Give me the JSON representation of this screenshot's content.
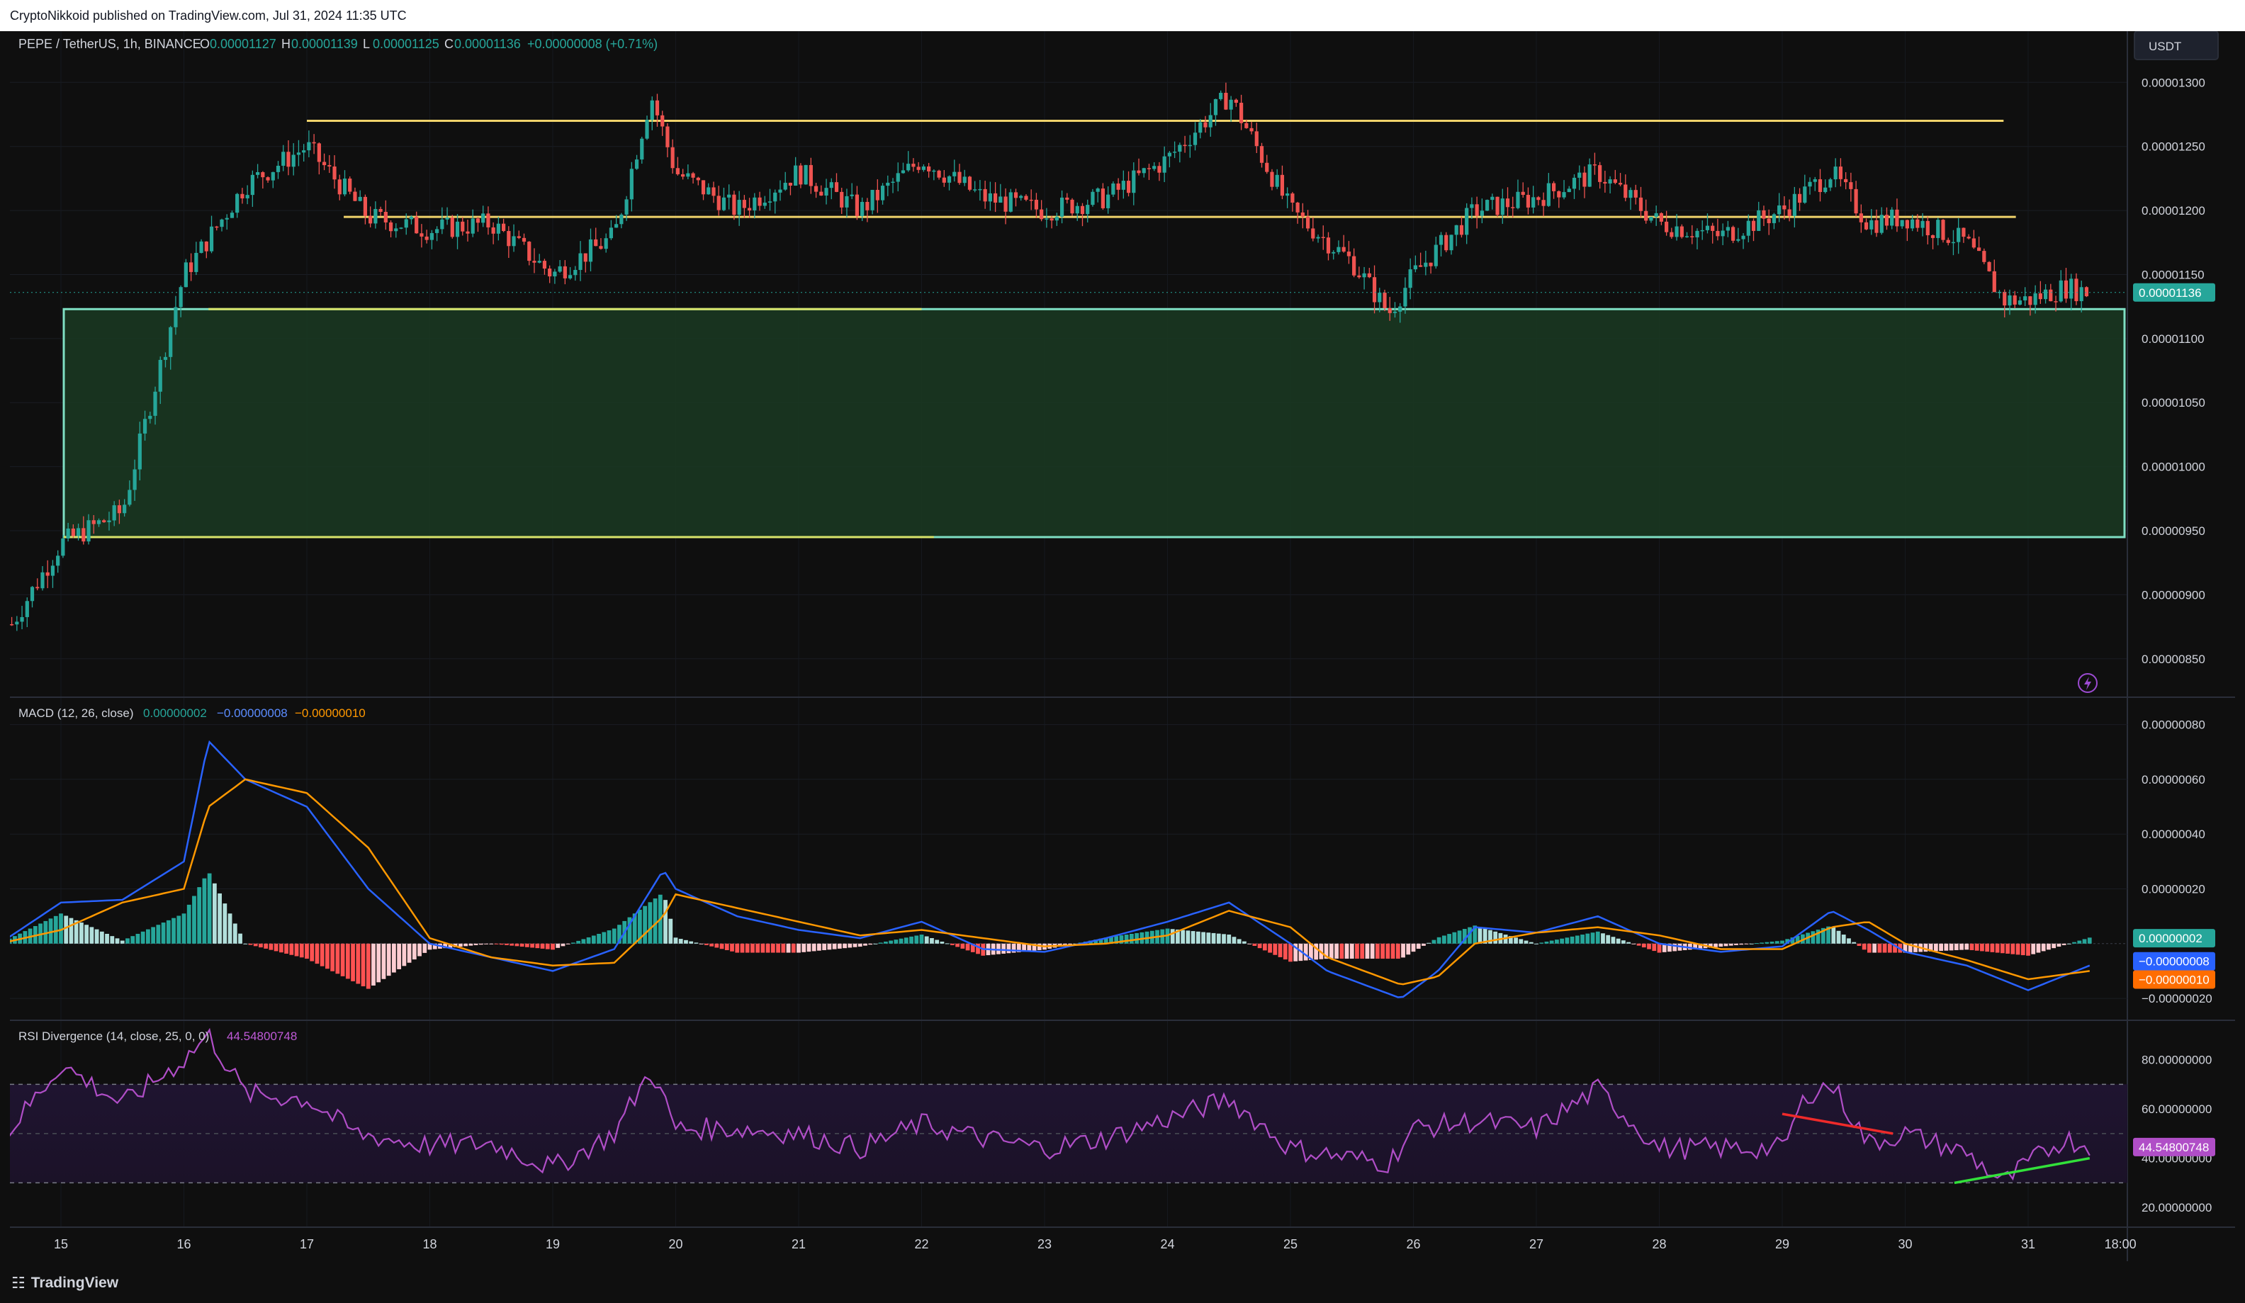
{
  "header": {
    "publisher": "CryptoNikkoid published on TradingView.com, Jul 31, 2024 11:35 UTC"
  },
  "footer": {
    "brand": "TradingView",
    "logo_glyph": "☷"
  },
  "currency_button": "USDT",
  "colors": {
    "up": "#26a69a",
    "down": "#ef5350",
    "zone": "#1b4d2a",
    "resistance": "#f0d36b",
    "macd": "#2962ff",
    "signal": "#ff9800",
    "rsi": "#b04ec7"
  },
  "price_pane": {
    "symbol": "PEPE / TetherUS, 1h, BINANCE",
    "ohlc": [
      {
        "k": "O",
        "v": "0.00001127"
      },
      {
        "k": "H",
        "v": "0.00001139"
      },
      {
        "k": "L",
        "v": "0.00001125"
      },
      {
        "k": "C",
        "v": "0.00001136"
      }
    ],
    "change": "+0.00000008 (+0.71%)",
    "last_price_label": "0.00001136",
    "y_ticks": [
      "0.00001300",
      "0.00001250",
      "0.00001200",
      "0.00001150",
      "0.00001100",
      "0.00001050",
      "0.00001000",
      "0.00000950",
      "0.00000900",
      "0.00000850"
    ],
    "alert_icon": "lightning-icon"
  },
  "macd_pane": {
    "title": "MACD (12, 26, close)",
    "v1": "0.00000002",
    "v2": "−0.00000008",
    "v3": "−0.00000010",
    "y_ticks": [
      "0.00000080",
      "0.00000060",
      "0.00000040",
      "0.00000020",
      "−0.00000020"
    ],
    "labels": [
      "0.00000002",
      "−0.00000008",
      "−0.00000010"
    ]
  },
  "rsi_pane": {
    "title": "RSI Divergence (14, close, 25, 0, 0)",
    "value": "44.54800748",
    "y_ticks": [
      "80.00000000",
      "60.00000000",
      "40.00000000",
      "20.00000000"
    ],
    "label": "44.54800748"
  },
  "time_axis": [
    "15",
    "16",
    "17",
    "18",
    "19",
    "20",
    "21",
    "22",
    "23",
    "24",
    "25",
    "26",
    "27",
    "28",
    "29",
    "30",
    "31",
    "18:00"
  ],
  "chart_data": {
    "type": "candlestick",
    "price_range": [
      8.2e-06,
      1.34e-05
    ],
    "x_days": [
      "15",
      "16",
      "17",
      "18",
      "19",
      "20",
      "21",
      "22",
      "23",
      "24",
      "25",
      "26",
      "27",
      "28",
      "29",
      "30",
      "31"
    ],
    "close_series_approx": [
      {
        "day": "14.6",
        "close": 8.77e-06
      },
      {
        "day": "15",
        "close": 9.4e-06
      },
      {
        "day": "15.5",
        "close": 9.65e-06
      },
      {
        "day": "16",
        "close": 1.15e-05
      },
      {
        "day": "16.5",
        "close": 1.22e-05
      },
      {
        "day": "17",
        "close": 1.25e-05
      },
      {
        "day": "17.5",
        "close": 1.195e-05
      },
      {
        "day": "18",
        "close": 1.185e-05
      },
      {
        "day": "18.5",
        "close": 1.19e-05
      },
      {
        "day": "19",
        "close": 1.15e-05
      },
      {
        "day": "19.5",
        "close": 1.18e-05
      },
      {
        "day": "19.8",
        "close": 1.29e-05
      },
      {
        "day": "20",
        "close": 1.23e-05
      },
      {
        "day": "20.5",
        "close": 1.2e-05
      },
      {
        "day": "21",
        "close": 1.23e-05
      },
      {
        "day": "21.5",
        "close": 1.2e-05
      },
      {
        "day": "22",
        "close": 1.24e-05
      },
      {
        "day": "22.5",
        "close": 1.21e-05
      },
      {
        "day": "23",
        "close": 1.2e-05
      },
      {
        "day": "23.5",
        "close": 1.21e-05
      },
      {
        "day": "24",
        "close": 1.24e-05
      },
      {
        "day": "24.5",
        "close": 1.29e-05
      },
      {
        "day": "25",
        "close": 1.2e-05
      },
      {
        "day": "25.5",
        "close": 1.16e-05
      },
      {
        "day": "25.8",
        "close": 1.12e-05
      },
      {
        "day": "26",
        "close": 1.15e-05
      },
      {
        "day": "26.5",
        "close": 1.2e-05
      },
      {
        "day": "27",
        "close": 1.21e-05
      },
      {
        "day": "27.5",
        "close": 1.23e-05
      },
      {
        "day": "28",
        "close": 1.19e-05
      },
      {
        "day": "28.5",
        "close": 1.18e-05
      },
      {
        "day": "29",
        "close": 1.2e-05
      },
      {
        "day": "29.4",
        "close": 1.23e-05
      },
      {
        "day": "29.7",
        "close": 1.19e-05
      },
      {
        "day": "30",
        "close": 1.195e-05
      },
      {
        "day": "30.5",
        "close": 1.175e-05
      },
      {
        "day": "30.8",
        "close": 1.13e-05
      },
      {
        "day": "31",
        "close": 1.13e-05
      },
      {
        "day": "31.3",
        "close": 1.14e-05
      },
      {
        "day": "31.5",
        "close": 1.136e-05
      }
    ],
    "support_zone": [
      9.45e-06,
      1.123e-05
    ],
    "resistance_lines": [
      1.27e-05,
      1.195e-05
    ],
    "macd": [
      {
        "day": "14.5",
        "macd": 0.0,
        "signal": 0.0
      },
      {
        "day": "15",
        "macd": 1.5e-07,
        "signal": 5e-08
      },
      {
        "day": "15.5",
        "macd": 1.6e-07,
        "signal": 1.5e-07
      },
      {
        "day": "16",
        "macd": 3e-07,
        "signal": 2e-07
      },
      {
        "day": "16.2",
        "macd": 7.4e-07,
        "signal": 5e-07
      },
      {
        "day": "16.5",
        "macd": 6e-07,
        "signal": 6e-07
      },
      {
        "day": "17",
        "macd": 5e-07,
        "signal": 5.5e-07
      },
      {
        "day": "17.5",
        "macd": 2e-07,
        "signal": 3.5e-07
      },
      {
        "day": "18",
        "macd": 0.0,
        "signal": 2e-08
      },
      {
        "day": "18.5",
        "macd": -5e-08,
        "signal": -5e-08
      },
      {
        "day": "19",
        "macd": -1e-07,
        "signal": -8e-08
      },
      {
        "day": "19.5",
        "macd": -2e-08,
        "signal": -7e-08
      },
      {
        "day": "19.9",
        "macd": 2.7e-07,
        "signal": 1e-07
      },
      {
        "day": "20",
        "macd": 2e-07,
        "signal": 1.8e-07
      },
      {
        "day": "20.5",
        "macd": 1e-07,
        "signal": 1.3e-07
      },
      {
        "day": "21",
        "macd": 5e-08,
        "signal": 8e-08
      },
      {
        "day": "21.5",
        "macd": 2e-08,
        "signal": 3e-08
      },
      {
        "day": "22",
        "macd": 8e-08,
        "signal": 5e-08
      },
      {
        "day": "22.5",
        "macd": -2e-08,
        "signal": 2e-08
      },
      {
        "day": "23",
        "macd": -3e-08,
        "signal": -1e-08
      },
      {
        "day": "23.5",
        "macd": 2e-08,
        "signal": 0.0
      },
      {
        "day": "24",
        "macd": 8e-08,
        "signal": 3e-08
      },
      {
        "day": "24.5",
        "macd": 1.5e-07,
        "signal": 1.2e-07
      },
      {
        "day": "25",
        "macd": 0.0,
        "signal": 6e-08
      },
      {
        "day": "25.3",
        "macd": -1e-07,
        "signal": -5e-08
      },
      {
        "day": "25.9",
        "macd": -2e-07,
        "signal": -1.5e-07
      },
      {
        "day": "26.2",
        "macd": -1e-07,
        "signal": -1.2e-07
      },
      {
        "day": "26.5",
        "macd": 6e-08,
        "signal": 0.0
      },
      {
        "day": "27",
        "macd": 4e-08,
        "signal": 4e-08
      },
      {
        "day": "27.5",
        "macd": 1e-07,
        "signal": 6e-08
      },
      {
        "day": "28",
        "macd": 0.0,
        "signal": 3e-08
      },
      {
        "day": "28.5",
        "macd": -3e-08,
        "signal": -2e-08
      },
      {
        "day": "29",
        "macd": -1e-08,
        "signal": -2e-08
      },
      {
        "day": "29.4",
        "macd": 1.2e-07,
        "signal": 6e-08
      },
      {
        "day": "29.7",
        "macd": 5e-08,
        "signal": 8e-08
      },
      {
        "day": "30",
        "macd": -3e-08,
        "signal": 0.0
      },
      {
        "day": "30.5",
        "macd": -8e-08,
        "signal": -6e-08
      },
      {
        "day": "31",
        "macd": -1.7e-07,
        "signal": -1.3e-07
      },
      {
        "day": "31.5",
        "macd": -8e-08,
        "signal": -1e-07
      }
    ],
    "rsi": [
      {
        "day": "14.5",
        "rsi": 46
      },
      {
        "day": "15",
        "rsi": 78
      },
      {
        "day": "15.5",
        "rsi": 62
      },
      {
        "day": "16",
        "rsi": 80
      },
      {
        "day": "16.2",
        "rsi": 90
      },
      {
        "day": "16.5",
        "rsi": 66
      },
      {
        "day": "17",
        "rsi": 64
      },
      {
        "day": "17.4",
        "rsi": 50
      },
      {
        "day": "18",
        "rsi": 45
      },
      {
        "day": "18.5",
        "rsi": 46
      },
      {
        "day": "19",
        "rsi": 36
      },
      {
        "day": "19.5",
        "rsi": 50
      },
      {
        "day": "19.8",
        "rsi": 76
      },
      {
        "day": "20",
        "rsi": 52
      },
      {
        "day": "20.5",
        "rsi": 52
      },
      {
        "day": "21",
        "rsi": 50
      },
      {
        "day": "21.5",
        "rsi": 44
      },
      {
        "day": "22",
        "rsi": 54
      },
      {
        "day": "22.5",
        "rsi": 48
      },
      {
        "day": "23",
        "rsi": 44
      },
      {
        "day": "23.5",
        "rsi": 48
      },
      {
        "day": "24",
        "rsi": 56
      },
      {
        "day": "24.5",
        "rsi": 64
      },
      {
        "day": "25",
        "rsi": 44
      },
      {
        "day": "25.5",
        "rsi": 40
      },
      {
        "day": "25.8",
        "rsi": 38
      },
      {
        "day": "26",
        "rsi": 52
      },
      {
        "day": "26.5",
        "rsi": 55
      },
      {
        "day": "27",
        "rsi": 52
      },
      {
        "day": "27.5",
        "rsi": 68
      },
      {
        "day": "28",
        "rsi": 44
      },
      {
        "day": "28.5",
        "rsi": 44
      },
      {
        "day": "29",
        "rsi": 44
      },
      {
        "day": "29.2",
        "rsi": 66
      },
      {
        "day": "29.4",
        "rsi": 70
      },
      {
        "day": "29.7",
        "rsi": 46
      },
      {
        "day": "30",
        "rsi": 50
      },
      {
        "day": "30.5",
        "rsi": 42
      },
      {
        "day": "30.8",
        "rsi": 30
      },
      {
        "day": "31",
        "rsi": 38
      },
      {
        "day": "31.3",
        "rsi": 48
      },
      {
        "day": "31.5",
        "rsi": 44.5
      }
    ],
    "rsi_bands": [
      70,
      30
    ],
    "divergence_lines": [
      {
        "kind": "bearish",
        "from": {
          "day": "29",
          "rsi": 58
        },
        "to": {
          "day": "29.9",
          "rsi": 50
        }
      },
      {
        "kind": "bullish",
        "from": {
          "day": "30.4",
          "rsi": 30
        },
        "to": {
          "day": "31.5",
          "rsi": 40
        }
      }
    ]
  }
}
